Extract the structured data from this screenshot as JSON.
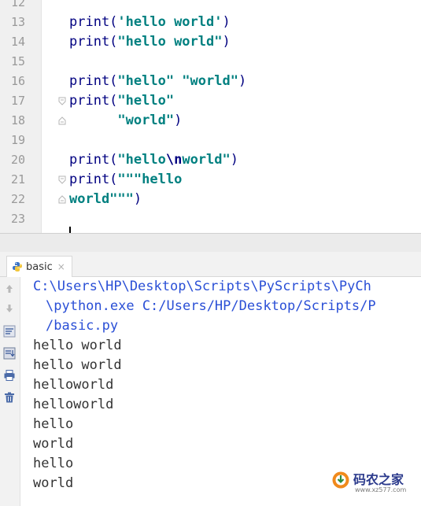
{
  "editor": {
    "lines": [
      {
        "num": "12",
        "parts": []
      },
      {
        "num": "13",
        "parts": [
          {
            "t": "print(",
            "c": "kw"
          },
          {
            "t": "'hello world'",
            "c": "str"
          },
          {
            "t": ")",
            "c": "kw"
          }
        ]
      },
      {
        "num": "14",
        "parts": [
          {
            "t": "print(",
            "c": "kw"
          },
          {
            "t": "\"hello world\"",
            "c": "str"
          },
          {
            "t": ")",
            "c": "kw"
          }
        ]
      },
      {
        "num": "15",
        "parts": []
      },
      {
        "num": "16",
        "parts": [
          {
            "t": "print(",
            "c": "kw"
          },
          {
            "t": "\"hello\" \"world\"",
            "c": "str"
          },
          {
            "t": ")",
            "c": "kw"
          }
        ]
      },
      {
        "num": "17",
        "fold": "open",
        "parts": [
          {
            "t": "print(",
            "c": "kw"
          },
          {
            "t": "\"hello\"",
            "c": "str"
          }
        ]
      },
      {
        "num": "18",
        "fold": "close",
        "parts": [
          {
            "t": "      ",
            "c": "kw"
          },
          {
            "t": "\"world\"",
            "c": "str"
          },
          {
            "t": ")",
            "c": "kw"
          }
        ]
      },
      {
        "num": "19",
        "parts": []
      },
      {
        "num": "20",
        "parts": [
          {
            "t": "print(",
            "c": "kw"
          },
          {
            "t": "\"hello",
            "c": "str"
          },
          {
            "t": "\\n",
            "c": "esc"
          },
          {
            "t": "world\"",
            "c": "str"
          },
          {
            "t": ")",
            "c": "kw"
          }
        ]
      },
      {
        "num": "21",
        "fold": "open",
        "parts": [
          {
            "t": "print(",
            "c": "kw"
          },
          {
            "t": "\"\"\"hello",
            "c": "str"
          }
        ]
      },
      {
        "num": "22",
        "fold": "close",
        "parts": [
          {
            "t": "world\"\"\"",
            "c": "str"
          },
          {
            "t": ")",
            "c": "kw"
          }
        ]
      },
      {
        "num": "23",
        "parts": []
      }
    ]
  },
  "run_panel": {
    "tab_label": "basic",
    "tab_close": "×",
    "toolbar_icons": [
      "up-arrow-icon",
      "down-arrow-icon",
      "soft-wrap-icon",
      "scroll-to-end-icon",
      "print-icon",
      "trash-icon"
    ]
  },
  "console": {
    "path_lines": [
      "C:\\Users\\HP\\Desktop\\Scripts\\PyScripts\\PyCh",
      "\\python.exe C:/Users/HP/Desktop/Scripts/P",
      "/basic.py"
    ],
    "output_lines": [
      "hello world",
      "hello world",
      "helloworld",
      "helloworld",
      "hello",
      "world",
      "hello",
      "world"
    ]
  },
  "watermark": {
    "title": "码农之家",
    "url": "www.xz577.com"
  },
  "colors": {
    "keyword": "#000080",
    "string": "#008080",
    "path": "#2a4fd6",
    "gutter": "#f0f0f0"
  }
}
